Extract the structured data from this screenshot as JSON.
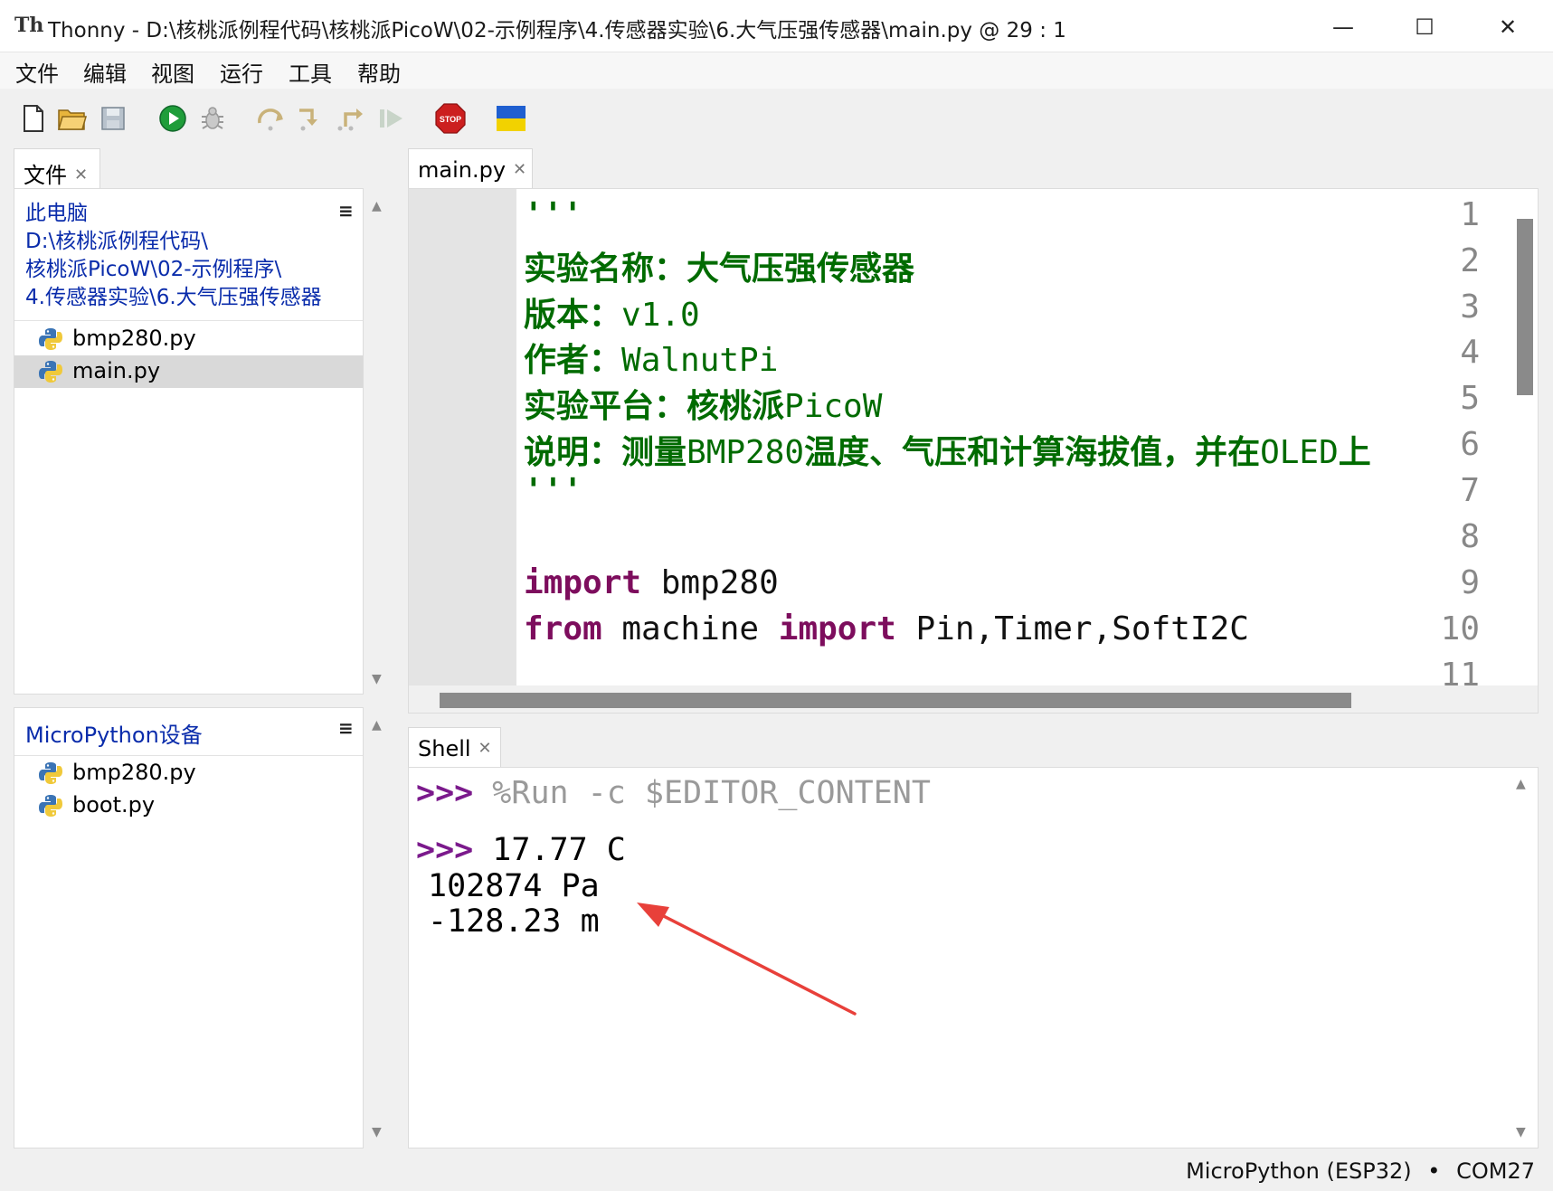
{
  "window": {
    "app_icon_text": "Th",
    "title": "Thonny  -  D:\\核桃派例程代码\\核桃派PicoW\\02-示例程序\\4.传感器实验\\6.大气压强传感器\\main.py  @  29 : 1",
    "minimize": "—",
    "maximize": "☐",
    "close": "✕"
  },
  "menu": [
    "文件",
    "编辑",
    "视图",
    "运行",
    "工具",
    "帮助"
  ],
  "toolbar": {
    "icons": [
      "new-file-icon",
      "open-folder-icon",
      "save-icon",
      "run-icon",
      "debug-icon",
      "step-over-icon",
      "step-into-icon",
      "step-out-icon",
      "resume-icon",
      "stop-icon",
      "ukraine-flag-icon"
    ],
    "stop_text": "STOP",
    "colors": {
      "run": "#1f9d3a",
      "stop": "#cc1f1f",
      "flag_blue": "#1f5fd0",
      "flag_yellow": "#f2d200"
    }
  },
  "files_panel": {
    "tab_label": "文件",
    "local_path": [
      "此电脑",
      "D:\\核桃派例程代码\\",
      "核桃派PicoW\\02-示例程序\\",
      "4.传感器实验\\6.大气压强传感器"
    ],
    "local_files": [
      {
        "name": "bmp280.py",
        "selected": false
      },
      {
        "name": "main.py",
        "selected": true
      }
    ],
    "device_header": "MicroPython设备",
    "device_files": [
      {
        "name": "bmp280.py"
      },
      {
        "name": "boot.py"
      }
    ]
  },
  "editor": {
    "tab_label": "main.py",
    "line_numbers": [
      "1",
      "2",
      "3",
      "4",
      "5",
      "6",
      "7",
      "8",
      "9",
      "10",
      "11"
    ],
    "lines": {
      "l1": "'''",
      "l2": "实验名称：大气压强传感器",
      "l3a": "版本：",
      "l3b": "v1.0",
      "l4a": "作者：",
      "l4b": "WalnutPi",
      "l5a": "实验平台：核桃派",
      "l5b": "PicoW",
      "l6a": "说明：测量",
      "l6b": "BMP280",
      "l6c": "温度、气压和计算海拔值，并在",
      "l6d": "OLED",
      "l6e": "上",
      "l7": "'''",
      "l9a": "import",
      "l9b": " bmp280",
      "l10a": "from",
      "l10b": " machine ",
      "l10c": "import",
      "l10d": " Pin,Timer,SoftI2C"
    }
  },
  "shell": {
    "tab_label": "Shell",
    "prompt": ">>>",
    "command": "%Run -c $EDITOR_CONTENT",
    "output": [
      "17.77 C",
      "102874 Pa",
      "-128.23 m"
    ]
  },
  "status": {
    "interpreter": "MicroPython (ESP32)",
    "separator": "•",
    "port": "COM27"
  },
  "annotation": {
    "arrow_color": "#e8403a"
  }
}
